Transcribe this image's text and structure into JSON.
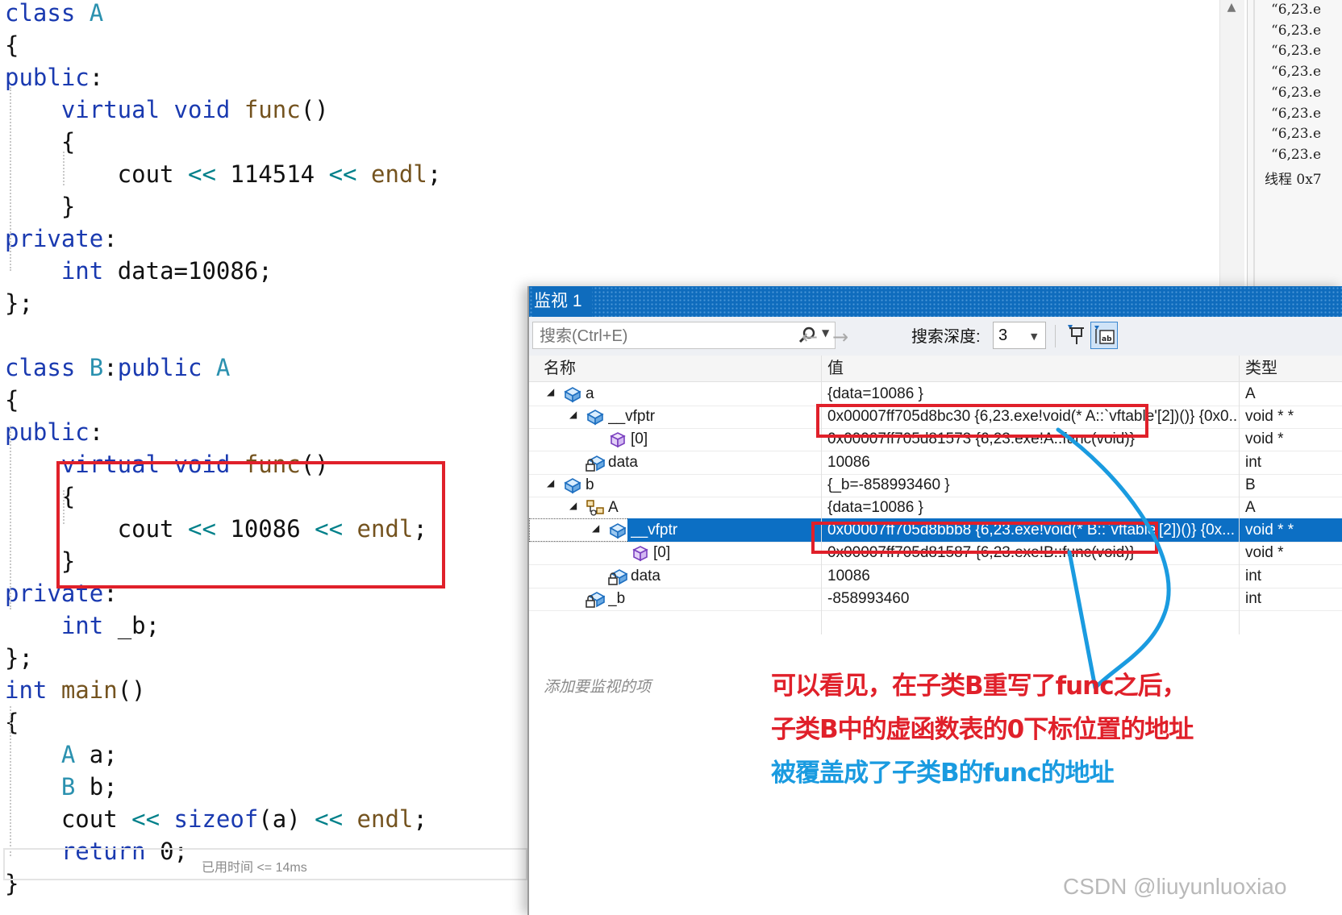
{
  "editor": {
    "lines": [
      {
        "segs": [
          {
            "t": "class ",
            "c": "kw"
          },
          {
            "t": "A",
            "c": "cls"
          }
        ]
      },
      {
        "segs": [
          {
            "t": "{",
            "c": ""
          }
        ]
      },
      {
        "segs": [
          {
            "t": "public",
            "c": "kw"
          },
          {
            "t": ":",
            "c": ""
          }
        ]
      },
      {
        "segs": [
          {
            "t": "    ",
            "c": ""
          },
          {
            "t": "virtual ",
            "c": "kw"
          },
          {
            "t": "void ",
            "c": "kw"
          },
          {
            "t": "func",
            "c": "fn"
          },
          {
            "t": "()",
            "c": ""
          }
        ]
      },
      {
        "segs": [
          {
            "t": "    {",
            "c": ""
          }
        ]
      },
      {
        "segs": [
          {
            "t": "        cout ",
            "c": ""
          },
          {
            "t": "<<",
            "c": "op"
          },
          {
            "t": " 114514 ",
            "c": ""
          },
          {
            "t": "<<",
            "c": "op"
          },
          {
            "t": " ",
            "c": ""
          },
          {
            "t": "endl",
            "c": "fn"
          },
          {
            "t": ";",
            "c": ""
          }
        ]
      },
      {
        "segs": [
          {
            "t": "    }",
            "c": ""
          }
        ]
      },
      {
        "segs": [
          {
            "t": "private",
            "c": "kw"
          },
          {
            "t": ":",
            "c": ""
          }
        ]
      },
      {
        "segs": [
          {
            "t": "    ",
            "c": ""
          },
          {
            "t": "int ",
            "c": "kw"
          },
          {
            "t": "data=10086;",
            "c": ""
          }
        ]
      },
      {
        "segs": [
          {
            "t": "};",
            "c": ""
          }
        ]
      },
      {
        "segs": []
      },
      {
        "segs": [
          {
            "t": "class ",
            "c": "kw"
          },
          {
            "t": "B",
            "c": "cls"
          },
          {
            "t": ":",
            "c": ""
          },
          {
            "t": "public ",
            "c": "kw"
          },
          {
            "t": "A",
            "c": "cls"
          }
        ]
      },
      {
        "segs": [
          {
            "t": "{",
            "c": ""
          }
        ]
      },
      {
        "segs": [
          {
            "t": "public",
            "c": "kw"
          },
          {
            "t": ":",
            "c": ""
          }
        ]
      },
      {
        "segs": [
          {
            "t": "    ",
            "c": ""
          },
          {
            "t": "virtual ",
            "c": "kw"
          },
          {
            "t": "void ",
            "c": "kw"
          },
          {
            "t": "func",
            "c": "fn"
          },
          {
            "t": "()",
            "c": ""
          }
        ]
      },
      {
        "segs": [
          {
            "t": "    {",
            "c": ""
          }
        ]
      },
      {
        "segs": [
          {
            "t": "        cout ",
            "c": ""
          },
          {
            "t": "<<",
            "c": "op"
          },
          {
            "t": " 10086 ",
            "c": ""
          },
          {
            "t": "<<",
            "c": "op"
          },
          {
            "t": " ",
            "c": ""
          },
          {
            "t": "endl",
            "c": "fn"
          },
          {
            "t": ";",
            "c": ""
          }
        ]
      },
      {
        "segs": [
          {
            "t": "    }",
            "c": ""
          }
        ]
      },
      {
        "segs": [
          {
            "t": "private",
            "c": "kw"
          },
          {
            "t": ":",
            "c": ""
          }
        ]
      },
      {
        "segs": [
          {
            "t": "    ",
            "c": ""
          },
          {
            "t": "int ",
            "c": "kw"
          },
          {
            "t": "_b;",
            "c": ""
          }
        ]
      },
      {
        "segs": [
          {
            "t": "};",
            "c": ""
          }
        ]
      },
      {
        "segs": [
          {
            "t": "int ",
            "c": "kw"
          },
          {
            "t": "main",
            "c": "fn"
          },
          {
            "t": "()",
            "c": ""
          }
        ]
      },
      {
        "segs": [
          {
            "t": "{",
            "c": ""
          }
        ]
      },
      {
        "segs": [
          {
            "t": "    ",
            "c": ""
          },
          {
            "t": "A ",
            "c": "cls"
          },
          {
            "t": "a;",
            "c": ""
          }
        ]
      },
      {
        "segs": [
          {
            "t": "    ",
            "c": ""
          },
          {
            "t": "B ",
            "c": "cls"
          },
          {
            "t": "b;",
            "c": ""
          }
        ]
      },
      {
        "segs": [
          {
            "t": "    cout ",
            "c": ""
          },
          {
            "t": "<<",
            "c": "op"
          },
          {
            "t": " ",
            "c": ""
          },
          {
            "t": "sizeof",
            "c": "kw"
          },
          {
            "t": "(a) ",
            "c": ""
          },
          {
            "t": "<<",
            "c": "op"
          },
          {
            "t": " ",
            "c": ""
          },
          {
            "t": "endl",
            "c": "fn"
          },
          {
            "t": ";",
            "c": ""
          }
        ]
      },
      {
        "segs": [
          {
            "t": "    ",
            "c": ""
          },
          {
            "t": "return ",
            "c": "kw"
          },
          {
            "t": "0;",
            "c": ""
          }
        ]
      },
      {
        "segs": [
          {
            "t": "}",
            "c": ""
          }
        ]
      }
    ],
    "elapsed_hint": "已用时间 <= 14ms"
  },
  "output_panel": {
    "lines": [
      "“6,23.e",
      "“6,23.e",
      "“6,23.e",
      "“6,23.e",
      "“6,23.e",
      "“6,23.e",
      "“6,23.e",
      "“6,23.e",
      "线程 0x7"
    ]
  },
  "watch": {
    "title": "监视 1",
    "search_placeholder": "搜索(Ctrl+E)",
    "depth_label": "搜索深度:",
    "depth_value": "3",
    "columns": {
      "name": "名称",
      "value": "值",
      "type": "类型"
    },
    "rows": [
      {
        "name": "a",
        "value": "{data=10086 }",
        "type": "A",
        "indent": 0,
        "expander": "open",
        "icon": "object",
        "selected": false
      },
      {
        "name": "__vfptr",
        "value": "0x00007ff705d8bc30 {6,23.exe!void(* A::`vftable'[2])()} {0x0...",
        "type": "void * *",
        "indent": 1,
        "expander": "open",
        "icon": "object",
        "selected": false
      },
      {
        "name": "[0]",
        "value": "0x00007ff705d81573 {6,23.exe!A::func(void)}",
        "type": "void *",
        "indent": 2,
        "expander": "none",
        "icon": "cube",
        "selected": false
      },
      {
        "name": "data",
        "value": "10086",
        "type": "int",
        "indent": 1,
        "expander": "none",
        "icon": "private-field",
        "selected": false
      },
      {
        "name": "b",
        "value": "{_b=-858993460 }",
        "type": "B",
        "indent": 0,
        "expander": "open",
        "icon": "object",
        "selected": false
      },
      {
        "name": "A",
        "value": "{data=10086 }",
        "type": "A",
        "indent": 1,
        "expander": "open",
        "icon": "base-class",
        "selected": false
      },
      {
        "name": "__vfptr",
        "value": "0x00007ff705d8bbb8 {6,23.exe!void(* B::`vftable'[2])()} {0x...",
        "type": "void * *",
        "indent": 2,
        "expander": "open",
        "icon": "object",
        "selected": true
      },
      {
        "name": "[0]",
        "value": "0x00007ff705d81587 {6,23.exe!B::func(void)}",
        "type": "void *",
        "indent": 3,
        "expander": "none",
        "icon": "cube",
        "selected": false
      },
      {
        "name": "data",
        "value": "10086",
        "type": "int",
        "indent": 2,
        "expander": "none",
        "icon": "private-field",
        "selected": false
      },
      {
        "name": "_b",
        "value": "-858993460",
        "type": "int",
        "indent": 1,
        "expander": "none",
        "icon": "private-field",
        "selected": false
      }
    ],
    "add_watch_placeholder": "添加要监视的项"
  },
  "annotations": {
    "line1": "可以看见，在子类B重写了func之后，",
    "line2": "子类B中的虚函数表的0下标位置的地址",
    "line3": "被覆盖成了子类B的func的地址",
    "red_color": "#e0202a",
    "blue_color": "#1a9be0"
  },
  "watermark": "CSDN @liuyunluoxiao"
}
